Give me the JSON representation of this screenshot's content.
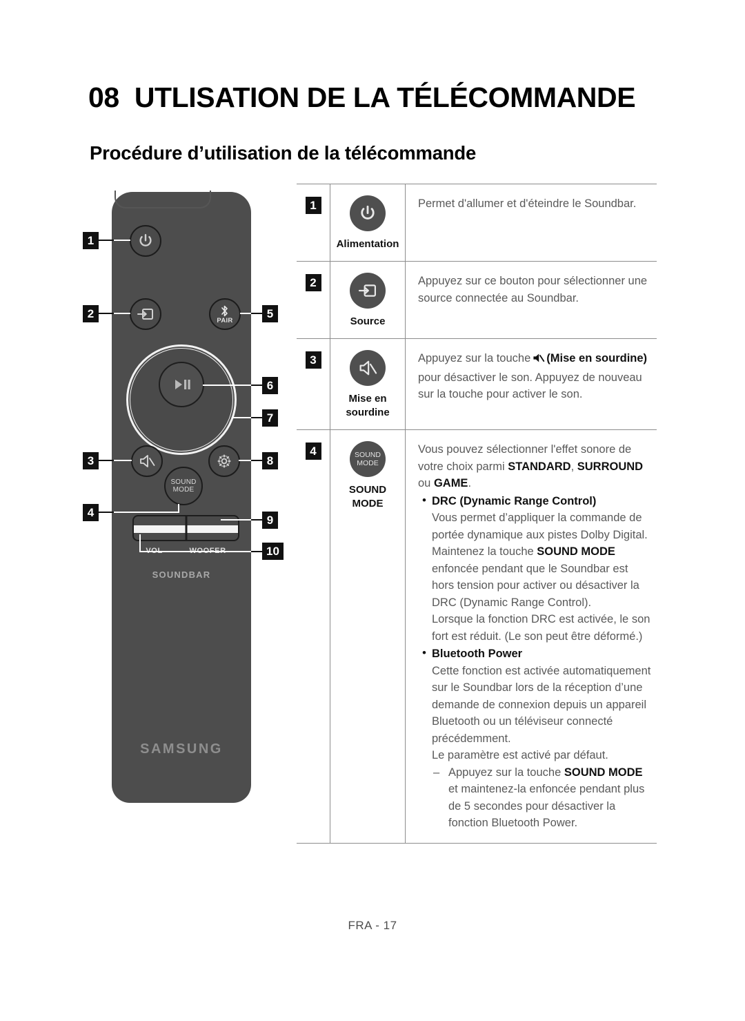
{
  "header": {
    "chapter_number": "08",
    "chapter_title": "UTLISATION DE LA TÉLÉCOMMANDE",
    "section_title": "Procédure d’utilisation de la télécommande"
  },
  "remote": {
    "pair_label": "PAIR",
    "sound_mode_line1": "SOUND",
    "sound_mode_line2": "MODE",
    "vol_label": "VOL",
    "woofer_label": "WOOFER",
    "soundbar_label": "SOUNDBAR",
    "brand_label": "SAMSUNG",
    "callouts": {
      "c1": "1",
      "c2": "2",
      "c3": "3",
      "c4": "4",
      "c5": "5",
      "c6": "6",
      "c7": "7",
      "c8": "8",
      "c9": "9",
      "c10": "10"
    }
  },
  "table": {
    "rows": [
      {
        "number": "1",
        "icon": "power-icon",
        "caption": "Alimentation",
        "description": "Permet d'allumer et d'éteindre le Soundbar."
      },
      {
        "number": "2",
        "icon": "source-input-icon",
        "caption": "Source",
        "description_line1": "Appuyez sur ce bouton pour sélectionner une",
        "description_line2": "source connectée au Soundbar."
      },
      {
        "number": "3",
        "icon": "mute-icon",
        "caption_line1": "Mise en",
        "caption_line2": "sourdine",
        "desc_part1": "Appuyez sur la touche",
        "desc_bold": "(Mise en sourdine)",
        "desc_part2": "pour désactiver le son.  Appuyez de nouveau sur la touche pour activer le son."
      },
      {
        "number": "4",
        "icon": "sound-mode-icon",
        "icon_text_line1": "SOUND",
        "icon_text_line2": "MODE",
        "caption": "SOUND MODE",
        "intro_part1": "Vous pouvez sélectionner l'effet sonore de votre choix parmi ",
        "intro_bold1": "STANDARD",
        "intro_sep1": ", ",
        "intro_bold2": "SURROUND",
        "intro_sep2": " ou ",
        "intro_bold3": "GAME",
        "intro_end": ".",
        "bullets": [
          {
            "heading": "DRC (Dynamic Range Control)",
            "body_part1": "Vous permet d’appliquer la commande de portée dynamique aux pistes Dolby Digital. Maintenez la touche ",
            "body_bold": "SOUND MODE",
            "body_part2": " enfoncée pendant que le Soundbar est hors tension pour activer ou désactiver la DRC (Dynamic Range Control).",
            "body_part3": "Lorsque la fonction DRC est activée, le son fort est réduit. (Le son peut être déformé.)"
          },
          {
            "heading": "Bluetooth Power",
            "body_part1": "Cette fonction est activée automatiquement sur le Soundbar lors de la réception d’une demande de connexion depuis un appareil Bluetooth ou un téléviseur connecté précédemment.",
            "body_part2": "Le paramètre est activé par défaut.",
            "sub_part1": "Appuyez sur la touche ",
            "sub_bold": "SOUND MODE",
            "sub_part2": " et maintenez-la enfoncée pendant plus de 5 secondes pour désactiver la fonction Bluetooth Power."
          }
        ]
      }
    ]
  },
  "footer": {
    "page_label": "FRA - 17"
  },
  "colors": {
    "remote_body": "#4d4d4d",
    "badge_bg": "#111111",
    "rule": "#8c8c8c",
    "body_text": "#595959"
  }
}
